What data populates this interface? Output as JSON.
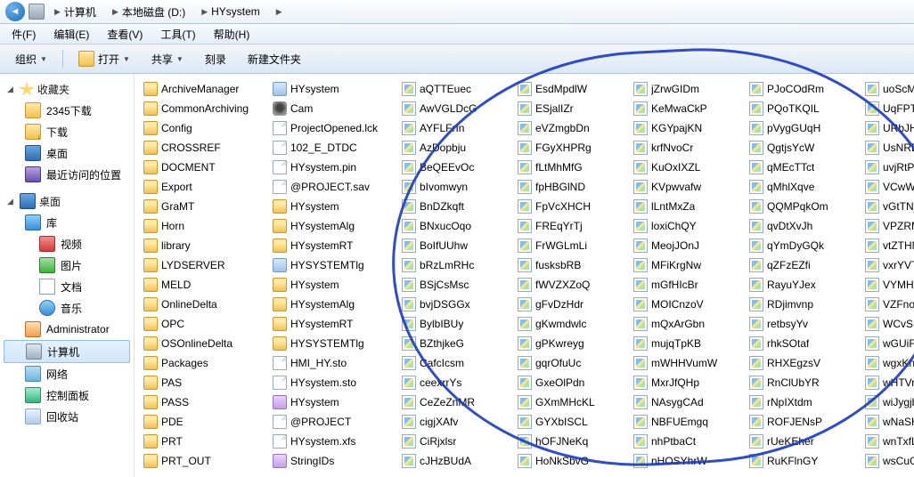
{
  "breadcrumb": [
    "计算机",
    "本地磁盘 (D:)",
    "HYsystem"
  ],
  "menus": [
    {
      "label": "件(F)"
    },
    {
      "label": "编辑(E)"
    },
    {
      "label": "查看(V)"
    },
    {
      "label": "工具(T)"
    },
    {
      "label": "帮助(H)"
    }
  ],
  "toolbar": {
    "organize": "组织",
    "open": "打开",
    "share": "共享",
    "burn": "刻录",
    "newfolder": "新建文件夹"
  },
  "sidebar": {
    "favorites": {
      "label": "收藏夹",
      "items": [
        {
          "icon": "folder",
          "label": "2345下载"
        },
        {
          "icon": "dl",
          "label": "下载"
        },
        {
          "icon": "desktop",
          "label": "桌面"
        },
        {
          "icon": "recent",
          "label": "最近访问的位置"
        }
      ]
    },
    "desktop": {
      "label": "桌面"
    },
    "libraries": {
      "label": "库",
      "items": [
        {
          "icon": "video",
          "label": "视频"
        },
        {
          "icon": "pic",
          "label": "图片"
        },
        {
          "icon": "doc",
          "label": "文档"
        },
        {
          "icon": "music",
          "label": "音乐"
        }
      ]
    },
    "admin": {
      "label": "Administrator"
    },
    "computer": {
      "label": "计算机"
    },
    "network": {
      "label": "网络"
    },
    "control": {
      "label": "控制面板"
    },
    "recycle": {
      "label": "回收站"
    }
  },
  "files": {
    "col0": [
      {
        "t": "folder",
        "n": "ArchiveManager"
      },
      {
        "t": "folder",
        "n": "CommonArchiving"
      },
      {
        "t": "folder",
        "n": "Config"
      },
      {
        "t": "folder",
        "n": "CROSSREF"
      },
      {
        "t": "folder",
        "n": "DOCMENT"
      },
      {
        "t": "folder",
        "n": "Export"
      },
      {
        "t": "folder",
        "n": "GraMT"
      },
      {
        "t": "folder",
        "n": "Horn"
      },
      {
        "t": "folder",
        "n": "library"
      },
      {
        "t": "folder",
        "n": "LYDSERVER"
      },
      {
        "t": "folder",
        "n": "MELD"
      },
      {
        "t": "folder",
        "n": "OnlineDelta"
      },
      {
        "t": "folder",
        "n": "OPC"
      },
      {
        "t": "folder",
        "n": "OSOnlineDelta"
      },
      {
        "t": "folder",
        "n": "Packages"
      },
      {
        "t": "folder",
        "n": "PAS"
      },
      {
        "t": "folder",
        "n": "PASS"
      },
      {
        "t": "folder",
        "n": "PDE"
      },
      {
        "t": "folder",
        "n": "PRT"
      },
      {
        "t": "folder",
        "n": "PRT_OUT"
      }
    ],
    "col1": [
      {
        "t": "app",
        "n": "HYsystem"
      },
      {
        "t": "cam",
        "n": "Cam"
      },
      {
        "t": "file",
        "n": "ProjectOpened.lck"
      },
      {
        "t": "file",
        "n": "102_E_DTDC"
      },
      {
        "t": "file",
        "n": "HYsystem.pin"
      },
      {
        "t": "file",
        "n": "@PROJECT.sav"
      },
      {
        "t": "folder",
        "n": "HYsystem"
      },
      {
        "t": "folder",
        "n": "HYsystemAlg"
      },
      {
        "t": "folder",
        "n": "HYsystemRT"
      },
      {
        "t": "app",
        "n": "HYSYSTEMTlg"
      },
      {
        "t": "folder",
        "n": "HYsystem"
      },
      {
        "t": "folder",
        "n": "HYsystemAlg"
      },
      {
        "t": "folder",
        "n": "HYsystemRT"
      },
      {
        "t": "folder",
        "n": "HYSYSTEMTlg"
      },
      {
        "t": "file",
        "n": "HMI_HY.sto"
      },
      {
        "t": "file",
        "n": "HYsystem.sto"
      },
      {
        "t": "str",
        "n": "HYsystem"
      },
      {
        "t": "file",
        "n": "@PROJECT"
      },
      {
        "t": "file",
        "n": "HYsystem.xfs"
      },
      {
        "t": "str",
        "n": "StringIDs"
      }
    ],
    "col2": [
      {
        "t": "img",
        "n": "aQTTEuec"
      },
      {
        "t": "img",
        "n": "AwVGLDcG"
      },
      {
        "t": "img",
        "n": "AYFLFrIn"
      },
      {
        "t": "img",
        "n": "AzDopbju"
      },
      {
        "t": "img",
        "n": "BeQEEvOc"
      },
      {
        "t": "img",
        "n": "bIvomwyn"
      },
      {
        "t": "img",
        "n": "BnDZkqft"
      },
      {
        "t": "img",
        "n": "BNxucOqo"
      },
      {
        "t": "img",
        "n": "BoIfUUhw"
      },
      {
        "t": "img",
        "n": "bRzLmRHc"
      },
      {
        "t": "img",
        "n": "BSjCsMsc"
      },
      {
        "t": "img",
        "n": "bvjDSGGx"
      },
      {
        "t": "img",
        "n": "BylbIBUy"
      },
      {
        "t": "img",
        "n": "BZthjkeG"
      },
      {
        "t": "img",
        "n": "CafcIcsm"
      },
      {
        "t": "img",
        "n": "ceexrrYs"
      },
      {
        "t": "img",
        "n": "CeZeZnMR"
      },
      {
        "t": "img",
        "n": "cigjXAfv"
      },
      {
        "t": "img",
        "n": "CiRjxlsr"
      },
      {
        "t": "img",
        "n": "cJHzBUdA"
      }
    ],
    "col3": [
      {
        "t": "img",
        "n": "EsdMpdlW"
      },
      {
        "t": "img",
        "n": "ESjalIZr"
      },
      {
        "t": "img",
        "n": "eVZmgbDn"
      },
      {
        "t": "img",
        "n": "FGyXHPRg"
      },
      {
        "t": "img",
        "n": "fLtMhMfG"
      },
      {
        "t": "img",
        "n": "fpHBGlND"
      },
      {
        "t": "img",
        "n": "FpVcXHCH"
      },
      {
        "t": "img",
        "n": "FREqYrTj"
      },
      {
        "t": "img",
        "n": "FrWGLmLi"
      },
      {
        "t": "img",
        "n": "fusksbRB"
      },
      {
        "t": "img",
        "n": "fWVZXZoQ"
      },
      {
        "t": "img",
        "n": "gFvDzHdr"
      },
      {
        "t": "img",
        "n": "gKwmdwlc"
      },
      {
        "t": "img",
        "n": "gPKwreyg"
      },
      {
        "t": "img",
        "n": "gqrOfuUc"
      },
      {
        "t": "img",
        "n": "GxeOlPdn"
      },
      {
        "t": "img",
        "n": "GXmMHcKL"
      },
      {
        "t": "img",
        "n": "GYXbISCL"
      },
      {
        "t": "img",
        "n": "hOFJNeKq"
      },
      {
        "t": "img",
        "n": "HoNkSbvG"
      }
    ],
    "col4": [
      {
        "t": "img",
        "n": "jZrwGIDm"
      },
      {
        "t": "img",
        "n": "KeMwaCkP"
      },
      {
        "t": "img",
        "n": "KGYpajKN"
      },
      {
        "t": "img",
        "n": "krfNvoCr"
      },
      {
        "t": "img",
        "n": "KuOxIXZL"
      },
      {
        "t": "img",
        "n": "KVpwvafw"
      },
      {
        "t": "img",
        "n": "lLntMxZa"
      },
      {
        "t": "img",
        "n": "loxiChQY"
      },
      {
        "t": "img",
        "n": "MeojJOnJ"
      },
      {
        "t": "img",
        "n": "MFiKrgNw"
      },
      {
        "t": "img",
        "n": "mGfHIcBr"
      },
      {
        "t": "img",
        "n": "MOICnzoV"
      },
      {
        "t": "img",
        "n": "mQxArGbn"
      },
      {
        "t": "img",
        "n": "mujqTpKB"
      },
      {
        "t": "img",
        "n": "mWHHVumW"
      },
      {
        "t": "img",
        "n": "MxrJfQHp"
      },
      {
        "t": "img",
        "n": "NAsygCAd"
      },
      {
        "t": "img",
        "n": "NBFUEmgq"
      },
      {
        "t": "img",
        "n": "nhPtbaCt"
      },
      {
        "t": "img",
        "n": "nHOSYhrW"
      }
    ],
    "col5": [
      {
        "t": "img",
        "n": "PJoCOdRm"
      },
      {
        "t": "img",
        "n": "PQoTKQIL"
      },
      {
        "t": "img",
        "n": "pVygGUqH"
      },
      {
        "t": "img",
        "n": "QgtjsYcW"
      },
      {
        "t": "img",
        "n": "qMEcTTct"
      },
      {
        "t": "img",
        "n": "qMhlXqve"
      },
      {
        "t": "img",
        "n": "QQMPqkOm"
      },
      {
        "t": "img",
        "n": "qvDtXvJh"
      },
      {
        "t": "img",
        "n": "qYmDyGQk"
      },
      {
        "t": "img",
        "n": "qZFzEZfi"
      },
      {
        "t": "img",
        "n": "RayuYJex"
      },
      {
        "t": "img",
        "n": "RDjimvnp"
      },
      {
        "t": "img",
        "n": "retbsyYv"
      },
      {
        "t": "img",
        "n": "rhkSOtaf"
      },
      {
        "t": "img",
        "n": "RHXEgzsV"
      },
      {
        "t": "img",
        "n": "RnClUbYR"
      },
      {
        "t": "img",
        "n": "rNpIXtdm"
      },
      {
        "t": "img",
        "n": "ROFJENsP"
      },
      {
        "t": "img",
        "n": "rUeKEher"
      },
      {
        "t": "img",
        "n": "RuKFlnGY"
      }
    ],
    "col6": [
      {
        "t": "img",
        "n": "uoScMFCF"
      },
      {
        "t": "img",
        "n": "UqFPTtWA"
      },
      {
        "t": "img",
        "n": "URbJHOm"
      },
      {
        "t": "img",
        "n": "UsNRDqY"
      },
      {
        "t": "img",
        "n": "uvjRtPwX"
      },
      {
        "t": "img",
        "n": "VCwWVjvF"
      },
      {
        "t": "img",
        "n": "vGtTNjSG"
      },
      {
        "t": "img",
        "n": "VPZRMFg"
      },
      {
        "t": "img",
        "n": "vtZTHNkK"
      },
      {
        "t": "img",
        "n": "vxrYVTVS"
      },
      {
        "t": "img",
        "n": "VYMHEDS"
      },
      {
        "t": "img",
        "n": "VZFnoGW"
      },
      {
        "t": "img",
        "n": "WCvSUCn"
      },
      {
        "t": "img",
        "n": "wGUiFrcg"
      },
      {
        "t": "img",
        "n": "wgxKnzpc"
      },
      {
        "t": "img",
        "n": "wHTVrWy"
      },
      {
        "t": "img",
        "n": "wiJygjbs"
      },
      {
        "t": "img",
        "n": "wNaSKWk"
      },
      {
        "t": "img",
        "n": "wnTxfLaW"
      },
      {
        "t": "img",
        "n": "wsCuGibs"
      }
    ]
  }
}
